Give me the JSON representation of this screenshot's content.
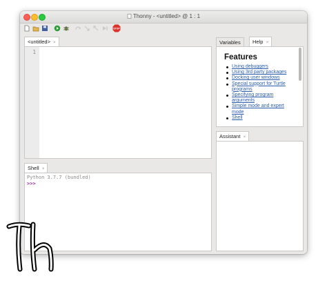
{
  "window": {
    "title": "Thonny  -  <untitled>  @  1 : 1"
  },
  "toolbar": {
    "icons": [
      "new-file-icon",
      "open-file-icon",
      "save-icon",
      "run-icon",
      "debug-icon",
      "step-over-icon",
      "step-into-icon",
      "step-out-icon",
      "resume-icon",
      "stop-icon"
    ],
    "stop_label": "STOP"
  },
  "editor": {
    "tab_label": "<untitled>",
    "close_glyph": "×",
    "line_number": "1"
  },
  "shell": {
    "tab_label": "Shell",
    "close_glyph": "×",
    "banner": "Python 3.7.7 (bundled)",
    "prompt": ">>>"
  },
  "right_top": {
    "tabs": [
      {
        "label": "Variables"
      },
      {
        "label": "Help",
        "close_glyph": "×"
      }
    ]
  },
  "help": {
    "heading": "Features",
    "items": [
      "Using debuggers",
      "Using 3rd party packages",
      "Docking user windows",
      "Special support for Turtle programs",
      "Specifying program arguments",
      "Simple mode and expert mode",
      "Shell"
    ]
  },
  "assistant": {
    "tab_label": "Assistant",
    "close_glyph": "×"
  },
  "logo": {
    "text": "Th"
  },
  "colors": {
    "link": "#2a5db0",
    "prompt": "#9a2aa0",
    "run_green": "#2e9e3a",
    "stop_red": "#d9342b"
  }
}
